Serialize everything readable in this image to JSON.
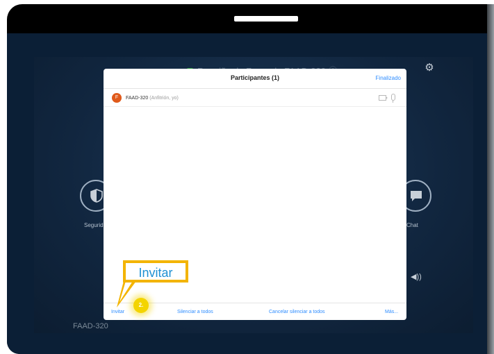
{
  "meeting": {
    "title": "Reunião de Zoom de FAAD-320 ⓘ",
    "bottom_name": "FAAD-320",
    "security_label": "Segurid",
    "chat_label": "Chat",
    "speaker_glyph": "◀))"
  },
  "participants_panel": {
    "title": "Participantes (1)",
    "done_label": "Finalizado",
    "participants": [
      {
        "initial": "F",
        "name": "FAAD-320",
        "role": "(Anfitrión, yo)"
      }
    ],
    "footer": {
      "invite_label": "Invitar",
      "mute_all_label": "Silenciar a todos",
      "unmute_all_label": "Cancelar silenciar a todos",
      "more_label": "Más..."
    }
  },
  "callout": {
    "text": "Invitar",
    "step": "2."
  },
  "colors": {
    "accent": "#2d8cff",
    "callout_border": "#f3b400",
    "avatar": "#e05a1b"
  }
}
